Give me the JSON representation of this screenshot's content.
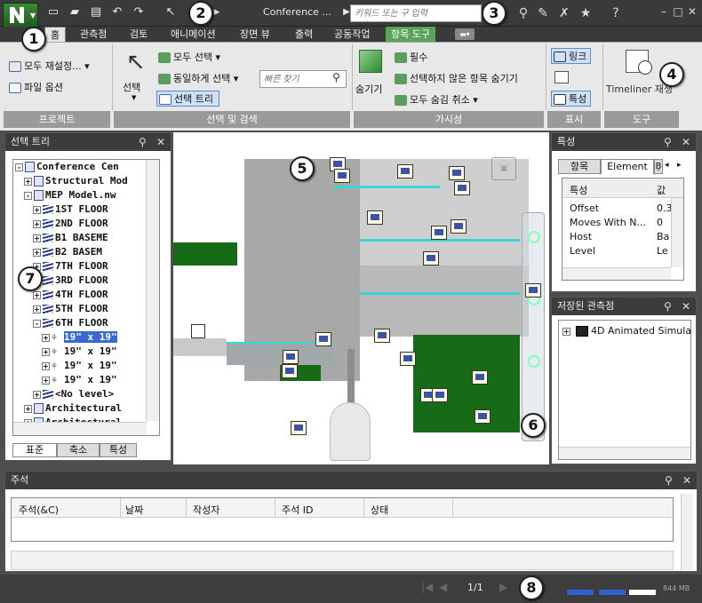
{
  "titlebar": {
    "doc_title": "Conference ...",
    "search_placeholder": "키워드 또는 구 입력"
  },
  "tabs": [
    "홈",
    "관측점",
    "검토",
    "애니메이션",
    "장면 뷰",
    "출력",
    "공동작업",
    "항목 도구"
  ],
  "ribbon": {
    "project": {
      "reset_all": "모두 재설정...",
      "file_options": "파일 옵션",
      "title": "프로젝트"
    },
    "select_search": {
      "select": "선택",
      "select_all": "모두 선택",
      "select_same": "동일하게 선택",
      "quick_find_placeholder": "빠른 찾기",
      "selection_tree": "선택 트리",
      "title": "선택 및 검색"
    },
    "visibility": {
      "hide": "숨기기",
      "required": "필수",
      "hide_unselected": "선택하지 않은 항목 숨기기",
      "unhide_all": "모두 숨김 취소",
      "title": "가시성"
    },
    "display": {
      "links": "링크",
      "properties": "특성",
      "title": "표시"
    },
    "tools": {
      "timeliner": "Timeliner",
      "timeliner_suffix": "재생",
      "title": "도구"
    }
  },
  "selection_tree": {
    "title": "선택 트리",
    "items": [
      {
        "text": "Conference Cen",
        "indent": 0,
        "toggle": "-",
        "icon": "doc"
      },
      {
        "text": "Structural Mod",
        "indent": 1,
        "toggle": "+",
        "icon": "doc"
      },
      {
        "text": "MEP Model.nw",
        "indent": 1,
        "toggle": "-",
        "icon": "doc"
      },
      {
        "text": "1ST FLOOR",
        "indent": 2,
        "toggle": "+",
        "icon": "layer"
      },
      {
        "text": "2ND FLOOR",
        "indent": 2,
        "toggle": "+",
        "icon": "layer"
      },
      {
        "text": "B1 BASEME",
        "indent": 2,
        "toggle": "+",
        "icon": "layer"
      },
      {
        "text": "B2  BASEM",
        "indent": 2,
        "toggle": "+",
        "icon": "layer"
      },
      {
        "text": "7TH FLOOR",
        "indent": 2,
        "toggle": "+",
        "icon": "layer"
      },
      {
        "text": "3RD FLOOR",
        "indent": 2,
        "toggle": "+",
        "icon": "layer"
      },
      {
        "text": "4TH FLOOR",
        "indent": 2,
        "toggle": "+",
        "icon": "layer"
      },
      {
        "text": "5TH FLOOR",
        "indent": 2,
        "toggle": "+",
        "icon": "layer"
      },
      {
        "text": "6TH FLOOR",
        "indent": 2,
        "toggle": "-",
        "icon": "layer"
      },
      {
        "text": "19\" x 19\"",
        "indent": 3,
        "toggle": "+",
        "icon": "geo",
        "selected": true
      },
      {
        "text": "19\" x 19\"",
        "indent": 3,
        "toggle": "+",
        "icon": "geo"
      },
      {
        "text": "19\" x 19\"",
        "indent": 3,
        "toggle": "+",
        "icon": "geo"
      },
      {
        "text": "19\" x 19\"",
        "indent": 3,
        "toggle": "+",
        "icon": "geo"
      },
      {
        "text": "<No level>",
        "indent": 2,
        "toggle": "+",
        "icon": "layer"
      },
      {
        "text": "Architectural",
        "indent": 1,
        "toggle": "+",
        "icon": "doc"
      },
      {
        "text": "Architectural",
        "indent": 1,
        "toggle": "+",
        "icon": "doc"
      }
    ],
    "bottom_tabs": [
      "표준",
      "축소",
      "특성"
    ]
  },
  "properties": {
    "title": "특성",
    "tabs": [
      "항목",
      "Element",
      "Ḇ"
    ],
    "col_header": "특성",
    "col_value": "값",
    "rows": [
      {
        "name": "Offset",
        "value": "0.3"
      },
      {
        "name": "Moves With N...",
        "value": "0"
      },
      {
        "name": "Host",
        "value": "Ba"
      },
      {
        "name": "Level",
        "value": "Le"
      }
    ]
  },
  "saved_viewpoints": {
    "title": "저장된 관측점",
    "item": "4D Animated Simula"
  },
  "comments": {
    "title": "주석",
    "columns": [
      "주석(&C)",
      "날짜",
      "작성자",
      "주석 ID",
      "상태"
    ]
  },
  "statusbar": {
    "page": "1/1",
    "memory": "844 MB"
  },
  "callouts": [
    "1",
    "2",
    "3",
    "4",
    "5",
    "6",
    "7",
    "8"
  ],
  "colors": {
    "app_green": "#2e7d32",
    "context_tab": "#5aa45a",
    "selection_blue": "#3a6ad0",
    "chrome_dark": "#3a3a3a"
  }
}
